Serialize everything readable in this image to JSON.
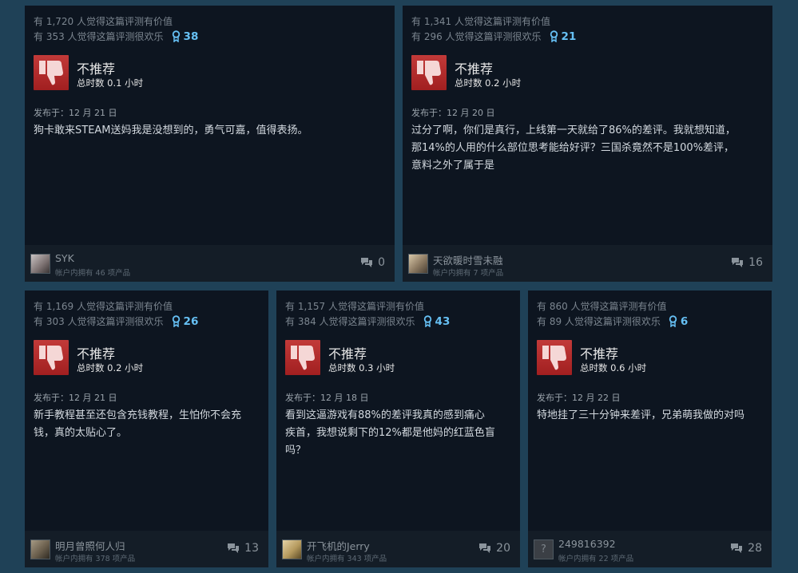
{
  "reviews": [
    {
      "helpful": "有 1,720 人觉得这篇评测有价值",
      "funny": "有 353 人觉得这篇评测很欢乐",
      "awards": "38",
      "verdict": "不推荐",
      "hours": "总时数 0.1 小时",
      "posted": "发布于：12 月 21 日",
      "text": [
        "狗卡敢来STEAM送妈我是没想到的，勇气可嘉，值得表扬。"
      ],
      "author": "SYK",
      "owned": "帐户内拥有 46 项产品",
      "comments": "0"
    },
    {
      "helpful": "有 1,341 人觉得这篇评测有价值",
      "funny": "有 296 人觉得这篇评测很欢乐",
      "awards": "21",
      "verdict": "不推荐",
      "hours": "总时数 0.2 小时",
      "posted": "发布于：12 月 20 日",
      "text": [
        "过分了啊，你们是真行，上线第一天就给了86%的差评。我就想知道，",
        "那14%的人用的什么部位思考能给好评？三国杀竟然不是100%差评，",
        "意料之外了属于是"
      ],
      "author": "天欲暖时雪未融",
      "owned": "帐户内拥有 7 项产品",
      "comments": "16"
    },
    {
      "helpful": "有 1,169 人觉得这篇评测有价值",
      "funny": "有 303 人觉得这篇评测很欢乐",
      "awards": "26",
      "verdict": "不推荐",
      "hours": "总时数 0.2 小时",
      "posted": "发布于：12 月 21 日",
      "text": [
        "新手教程甚至还包含充钱教程，生怕你不会充",
        "钱，真的太贴心了。"
      ],
      "author": "明月曾照何人归",
      "owned": "帐户内拥有 378 项产品",
      "comments": "13"
    },
    {
      "helpful": "有 1,157 人觉得这篇评测有价值",
      "funny": "有 384 人觉得这篇评测很欢乐",
      "awards": "43",
      "verdict": "不推荐",
      "hours": "总时数 0.3 小时",
      "posted": "发布于：12 月 18 日",
      "text": [
        "看到这逼游戏有88%的差评我真的感到痛心",
        "疾首，我想说剩下的12%都是他妈的红蓝色盲",
        "吗？"
      ],
      "author": "开飞机的Jerry",
      "owned": "帐户内拥有 343 项产品",
      "comments": "20"
    },
    {
      "helpful": "有 860 人觉得这篇评测有价值",
      "funny": "有 89 人觉得这篇评测很欢乐",
      "awards": "6",
      "verdict": "不推荐",
      "hours": "总时数 0.6 小时",
      "posted": "发布于：12 月 22 日",
      "text": [
        "特地挂了三十分钟来差评，兄弟萌我做的对吗"
      ],
      "author": "249816392",
      "owned": "帐户内拥有 22 项产品",
      "comments": "28"
    }
  ],
  "colors": {
    "accent": "#66c0f4",
    "thumb_down": "#c23a39",
    "card": "#0d1520",
    "footer": "#141d27"
  }
}
